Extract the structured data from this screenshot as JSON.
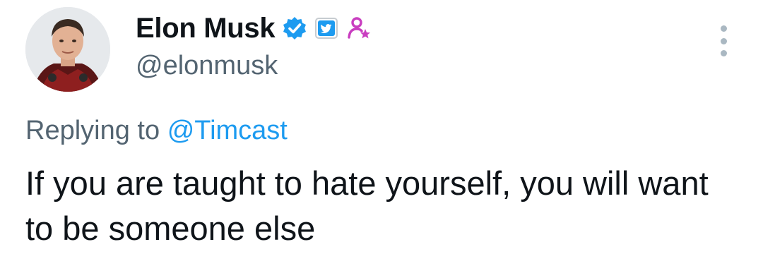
{
  "author": {
    "display_name": "Elon Musk",
    "handle": "@elonmusk",
    "avatar_icon": "profile-photo",
    "badges": [
      "verified-badge-icon",
      "twitter-logo-badge-icon",
      "affiliate-user-star-icon"
    ]
  },
  "reply": {
    "prefix": "Replying to",
    "mention": "@Timcast"
  },
  "tweet": {
    "text": "If you are taught to hate yourself, you will want to be someone else"
  },
  "colors": {
    "link_blue": "#1d9bf0",
    "verified_blue": "#1d9bf0",
    "affiliate_magenta": "#c93ec0",
    "secondary_text": "#536471"
  }
}
